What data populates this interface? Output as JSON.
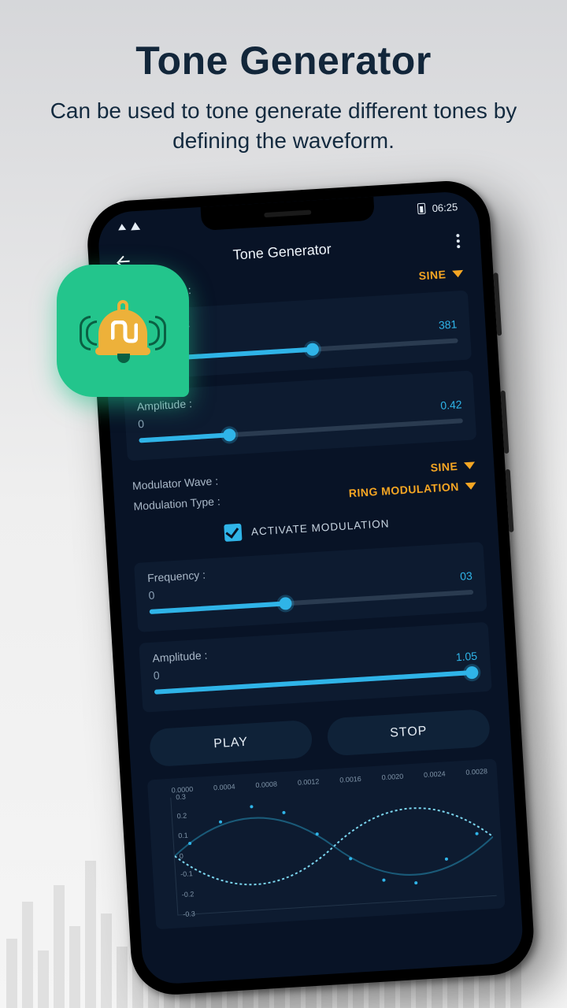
{
  "promo": {
    "title": "Tone Generator",
    "subtitle": "Can be used to tone generate different tones by defining the waveform."
  },
  "status": {
    "time": "06:25"
  },
  "header": {
    "title": "Tone Generator"
  },
  "carrier": {
    "label": "Carrier Wave :",
    "value": "SINE",
    "freq_label": "Frequency :",
    "freq_min": "0",
    "freq_value": "381",
    "freq_pct": 55,
    "amp_label": "Amplitude :",
    "amp_min": "0",
    "amp_value": "0.42",
    "amp_pct": 28
  },
  "modulator": {
    "wave_label": "Modulator Wave :",
    "wave_value": "SINE",
    "type_label": "Modulation Type :",
    "type_value": "RING MODULATION",
    "activate_label": "ACTIVATE MODULATION",
    "freq_label": "Frequency :",
    "freq_min": "0",
    "freq_value": "03",
    "freq_pct": 42,
    "amp_label": "Amplitude :",
    "amp_min": "0",
    "amp_value": "1.05",
    "amp_pct": 98
  },
  "buttons": {
    "play": "PLAY",
    "stop": "STOP"
  },
  "chart_data": {
    "type": "line",
    "xticks": [
      "0.0000",
      "0.0004",
      "0.0008",
      "0.0012",
      "0.0016",
      "0.0020",
      "0.0024",
      "0.0028"
    ],
    "yticks": [
      "0.3",
      "0.2",
      "0.1",
      "0",
      "-0.1",
      "-0.2",
      "-0.3"
    ],
    "ylim": [
      -0.3,
      0.3
    ]
  },
  "badge": {
    "icon": "bell"
  }
}
